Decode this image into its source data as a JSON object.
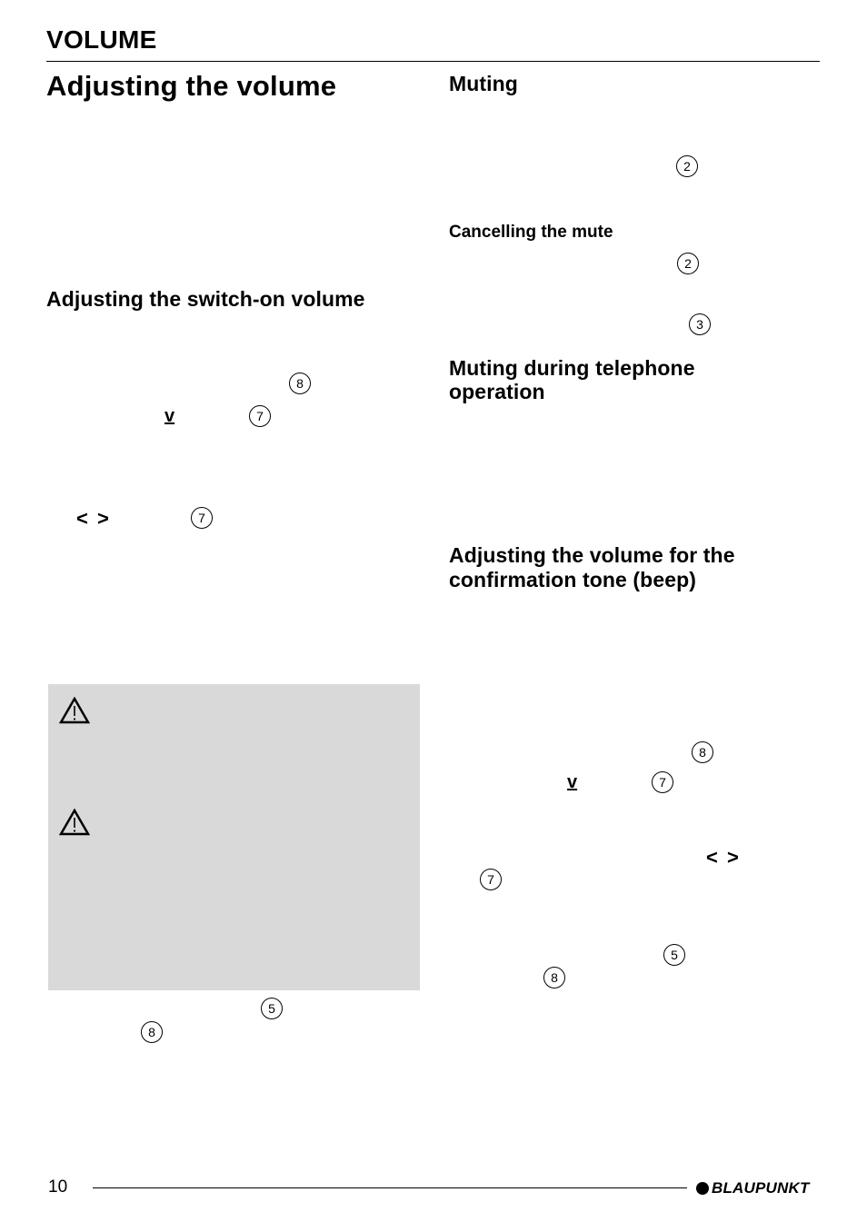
{
  "header": {
    "section_title": "VOLUME"
  },
  "left_column": {
    "title": "Adjusting the volume",
    "switch_on": {
      "heading": "Adjusting the switch-on volume",
      "refs": [
        "8",
        "7",
        "7"
      ],
      "down_key_label": "v",
      "left_right_key_label": "< >"
    },
    "note_box": {
      "icons": [
        "warning-icon",
        "warning-icon"
      ]
    },
    "after_box_refs": [
      "5",
      "8"
    ]
  },
  "right_column": {
    "muting": {
      "heading": "Muting",
      "refs": [
        "2"
      ]
    },
    "cancel_mute": {
      "heading": "Cancelling the mute",
      "refs": [
        "2",
        "3"
      ]
    },
    "telephone": {
      "heading_line1": "Muting during telephone",
      "heading_line2": "operation"
    },
    "beep": {
      "heading_line1": "Adjusting the volume for the",
      "heading_line2": "confirmation tone (beep)",
      "refs": [
        "8",
        "7",
        "7",
        "5",
        "8"
      ],
      "down_key_label": "v",
      "left_right_key_label": "< >"
    }
  },
  "footer": {
    "page_number": "10",
    "brand": "BLAUPUNKT"
  }
}
